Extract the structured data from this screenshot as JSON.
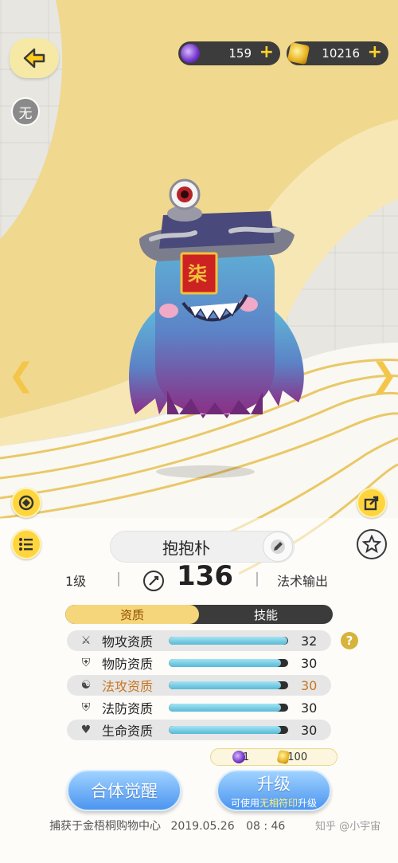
{
  "currency": {
    "orb_amount": "159",
    "gold_amount": "10216",
    "plus": "+"
  },
  "element_badge": "无",
  "pet": {
    "name": "抱抱朴",
    "level": "1级",
    "power": "136",
    "role": "法术输出",
    "hat_seal": "柒"
  },
  "tabs": [
    {
      "label": "资质",
      "active": true
    },
    {
      "label": "技能",
      "active": false
    }
  ],
  "stats": [
    {
      "label": "物攻资质",
      "value": "32",
      "fill": 0.99,
      "icon": "crossed-swords-icon",
      "highlight": false
    },
    {
      "label": "物防资质",
      "value": "30",
      "fill": 0.94,
      "icon": "shield-icon",
      "highlight": false
    },
    {
      "label": "法攻资质",
      "value": "30",
      "fill": 0.94,
      "icon": "yin-yang-icon",
      "highlight": true
    },
    {
      "label": "法防资质",
      "value": "30",
      "fill": 0.94,
      "icon": "magic-shield-icon",
      "highlight": false
    },
    {
      "label": "生命资质",
      "value": "30",
      "fill": 0.94,
      "icon": "heart-icon",
      "highlight": false
    }
  ],
  "help": "?",
  "upgrade_cost": {
    "orb": "1",
    "gold": "100"
  },
  "buttons": {
    "awaken": "合体觉醒",
    "upgrade": "升级",
    "upgrade_sub_prefix": "可使用",
    "upgrade_sub_highlight": "无相符印",
    "upgrade_sub_suffix": "升级"
  },
  "footer": {
    "capture_text": "捕获于金梧桐购物中心",
    "date": "2019.05.26",
    "time": "08 : 46"
  },
  "watermark": "知乎 @小宇宙",
  "colors": {
    "gold_accent": "#f3c64a",
    "stat_highlight": "#c9761f",
    "button_blue": "#4c95f0"
  }
}
